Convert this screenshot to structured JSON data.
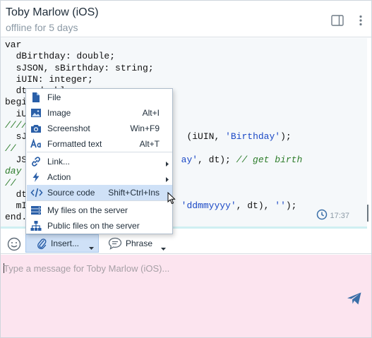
{
  "header": {
    "contact_name": "Toby Marlow (iOS)",
    "contact_status": "offline for 5 days"
  },
  "message": {
    "code_lines": [
      [
        {
          "t": "var",
          "c": ""
        }
      ],
      [
        {
          "t": "  dBirthday: double;",
          "c": ""
        }
      ],
      [
        {
          "t": "  sJSON, sBirthday: string;",
          "c": ""
        }
      ],
      [
        {
          "t": "  iUIN: integer;",
          "c": ""
        }
      ],
      [
        {
          "t": "  dt: double;",
          "c": ""
        }
      ],
      [
        {
          "t": "begi",
          "c": ""
        }
      ],
      [
        {
          "t": "  iU",
          "c": ""
        }
      ],
      [
        {
          "t": "////",
          "c": "cmt"
        }
      ],
      [
        {
          "t": "  sJ                             (iUIN, ",
          "c": ""
        },
        {
          "t": "'Birthday'",
          "c": "str"
        },
        {
          "t": ");",
          "c": ""
        }
      ],
      [
        {
          "t": "//",
          "c": "cmt"
        }
      ],
      [
        {
          "t": "  JS                            ",
          "c": ""
        },
        {
          "t": "ay'",
          "c": "str"
        },
        {
          "t": ", dt); ",
          "c": ""
        },
        {
          "t": "// get birth",
          "c": "cmt"
        }
      ],
      [
        {
          "t": "day",
          "c": "cmt"
        }
      ],
      [
        {
          "t": "//",
          "c": "cmt"
        }
      ],
      [
        {
          "t": "  dt",
          "c": ""
        }
      ],
      [
        {
          "t": "  mI                            ",
          "c": ""
        },
        {
          "t": "'ddmmyyyy'",
          "c": "str"
        },
        {
          "t": ", dt), ",
          "c": ""
        },
        {
          "t": "''",
          "c": "str"
        },
        {
          "t": ");",
          "c": ""
        }
      ],
      [
        {
          "t": "end.",
          "c": ""
        }
      ]
    ],
    "time": "17:37"
  },
  "toolbar": {
    "insert_label": "Insert...",
    "phrase_label": "Phrase"
  },
  "composer": {
    "placeholder": "Type a message for Toby Marlow (iOS)..."
  },
  "insert_menu": {
    "items": [
      {
        "label": "File",
        "shortcut": "",
        "icon": "file-icon",
        "submenu": false
      },
      {
        "label": "Image",
        "shortcut": "Alt+I",
        "icon": "image-icon",
        "submenu": false
      },
      {
        "label": "Screenshot",
        "shortcut": "Win+F9",
        "icon": "camera-icon",
        "submenu": false
      },
      {
        "label": "Formatted text",
        "shortcut": "Alt+T",
        "icon": "formatted-text-icon",
        "submenu": false
      },
      {
        "label": "Link...",
        "shortcut": "",
        "icon": "link-icon",
        "submenu": true
      },
      {
        "label": "Action",
        "shortcut": "",
        "icon": "lightning-icon",
        "submenu": true
      },
      {
        "label": "Source code",
        "shortcut": "Shift+Ctrl+Ins",
        "icon": "code-icon",
        "submenu": false
      },
      {
        "label": "My files on the server",
        "shortcut": "",
        "icon": "server-files-icon",
        "submenu": false
      },
      {
        "label": "Public files on the server",
        "shortcut": "",
        "icon": "public-files-icon",
        "submenu": false
      }
    ],
    "highlighted": "Source code"
  },
  "colors": {
    "accent": "#2a6fb8",
    "menu_highlight": "#cfe1f7",
    "composer_bg": "#fce4ef",
    "code_string": "#1b49c6",
    "code_comment": "#2c7c2a"
  }
}
